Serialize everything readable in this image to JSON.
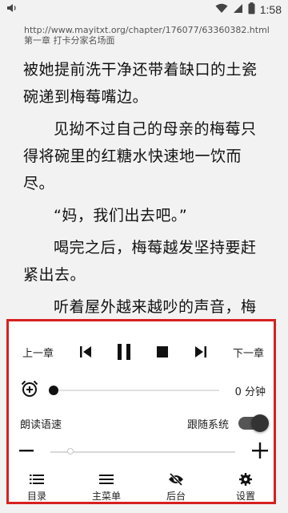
{
  "status": {
    "time": "1:58"
  },
  "reader": {
    "url": "http://www.mayitxt.org/chapter/176077/63360382.html",
    "chapter_title": "第一章 打卡分家名场面",
    "paragraphs": [
      "被她提前洗干净还带着缺口的土瓷碗递到梅莓嘴边。",
      "见拗不过自己的母亲的梅莓只得将碗里的红糖水快速地一饮而尽。",
      "“妈，我们出去吧。”",
      "喝完之后，梅莓越发坚持要赶紧出去。",
      "听着屋外越来越吵的声音，梅莓便知道她想要看见的场景就要发生了，我还来不及去接她过来照顾她。"
    ]
  },
  "tts_panel": {
    "prev_chapter": "上一章",
    "next_chapter": "下一章",
    "timer_value": "0 分钟",
    "timer_fraction": 0,
    "read_speed_label": "朗读语速",
    "follow_system_label": "跟随系统",
    "follow_system_on": true,
    "speed_fraction": 0.11,
    "nav": {
      "toc": "目录",
      "main_menu": "主菜单",
      "background": "后台",
      "settings": "设置"
    }
  },
  "colors": {
    "panel_border": "#d62020",
    "panel_bg": "#ffffff",
    "page_bg": "#f2f2f2"
  }
}
